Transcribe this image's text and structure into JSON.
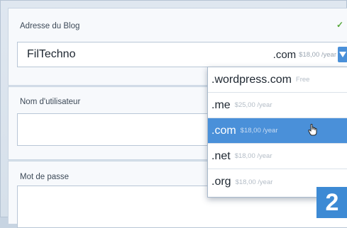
{
  "blog_address": {
    "label": "Adresse du Blog",
    "value": "FilTechno",
    "check": "✓",
    "selected_tld": ".com",
    "selected_price": "$18,00 /year"
  },
  "username": {
    "label": "Nom d'utilisateur",
    "value": ""
  },
  "password": {
    "label": "Mot de passe",
    "value": ""
  },
  "dropdown": {
    "options": [
      {
        "tld": ".wordpress.com",
        "price": "Free"
      },
      {
        "tld": ".me",
        "price": "$25,00 /year"
      },
      {
        "tld": ".com",
        "price": "$18,00 /year",
        "selected": true
      },
      {
        "tld": ".net",
        "price": "$18,00 /year"
      },
      {
        "tld": ".org",
        "price": "$18,00 /year"
      }
    ]
  },
  "step_badge": "2",
  "colors": {
    "accent": "#4a90d9",
    "badge": "#3d8ad4",
    "check": "#58a83c"
  },
  "icons": {
    "dropdown_arrow": "chevron-down-icon",
    "cursor": "hand-pointer-icon",
    "check": "check-icon"
  }
}
